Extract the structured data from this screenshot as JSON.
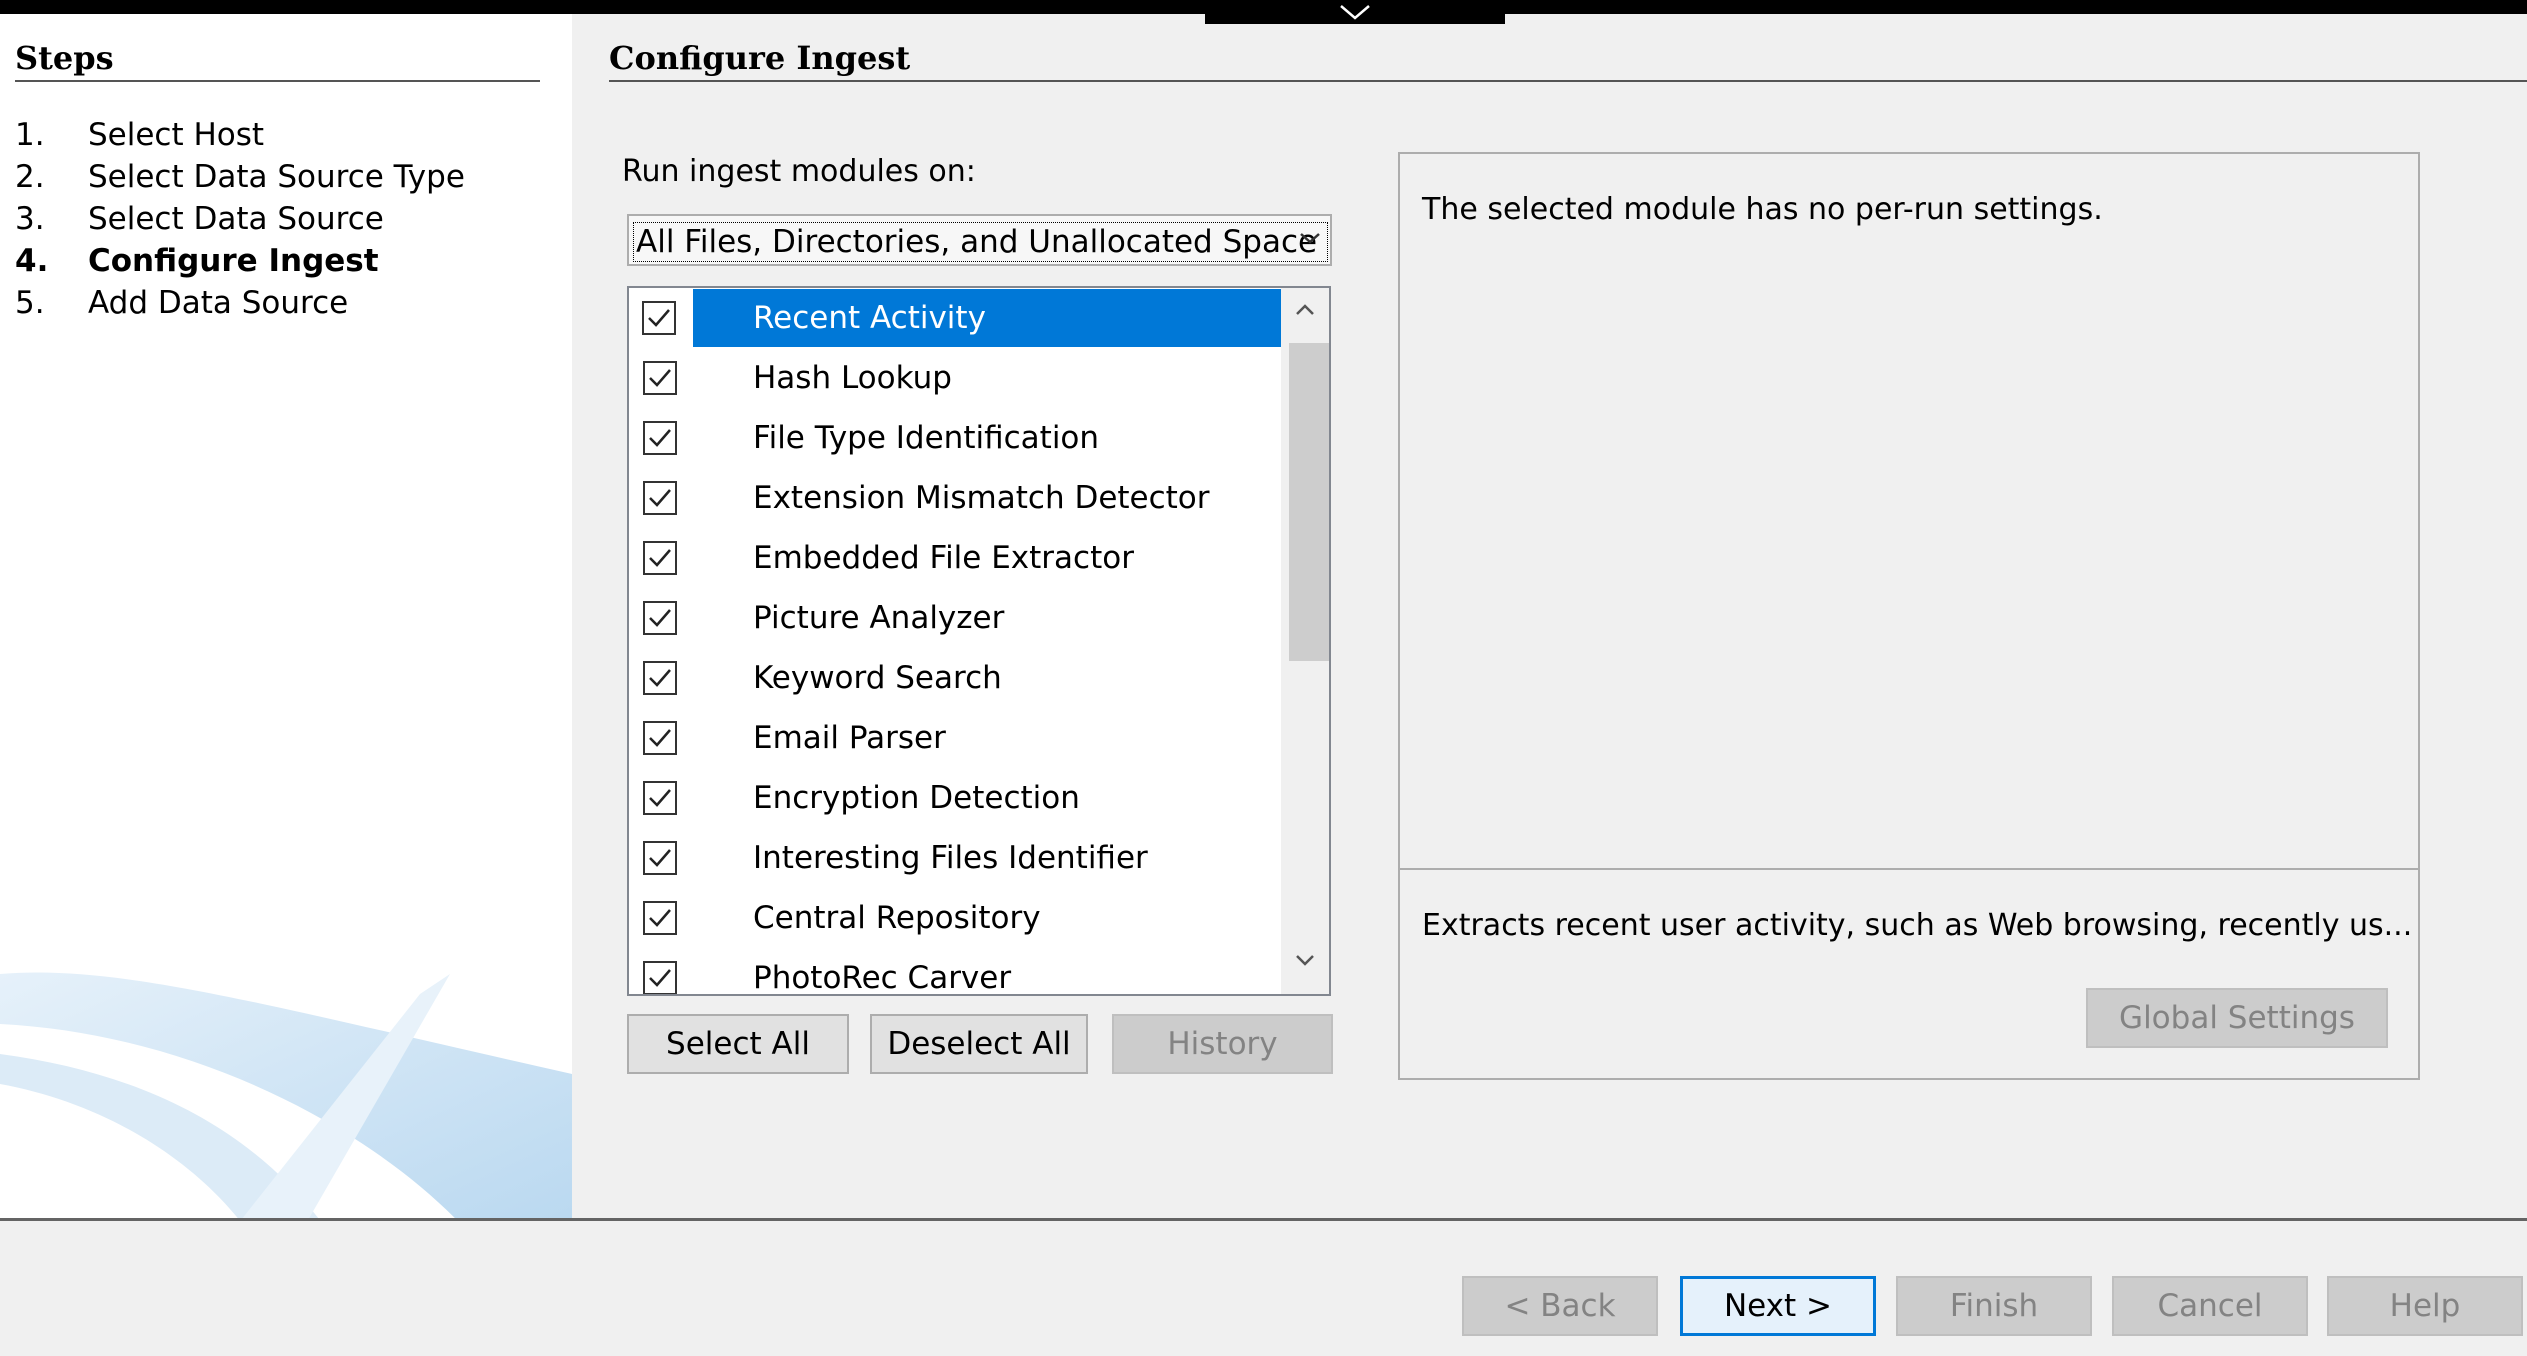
{
  "steps": {
    "title": "Steps",
    "items": [
      {
        "num": "1.",
        "label": "Select Host",
        "current": false
      },
      {
        "num": "2.",
        "label": "Select Data Source Type",
        "current": false
      },
      {
        "num": "3.",
        "label": "Select Data Source",
        "current": false
      },
      {
        "num": "4.",
        "label": "Configure Ingest",
        "current": true
      },
      {
        "num": "5.",
        "label": "Add Data Source",
        "current": false
      }
    ]
  },
  "main": {
    "title": "Configure Ingest",
    "run_label": "Run ingest modules on:",
    "run_value": "All Files, Directories, and Unallocated Space",
    "modules": [
      {
        "label": "Recent Activity",
        "checked": true,
        "selected": true
      },
      {
        "label": "Hash Lookup",
        "checked": true,
        "selected": false
      },
      {
        "label": "File Type Identification",
        "checked": true,
        "selected": false
      },
      {
        "label": "Extension Mismatch Detector",
        "checked": true,
        "selected": false
      },
      {
        "label": "Embedded File Extractor",
        "checked": true,
        "selected": false
      },
      {
        "label": "Picture Analyzer",
        "checked": true,
        "selected": false
      },
      {
        "label": "Keyword Search",
        "checked": true,
        "selected": false
      },
      {
        "label": "Email Parser",
        "checked": true,
        "selected": false
      },
      {
        "label": "Encryption Detection",
        "checked": true,
        "selected": false
      },
      {
        "label": "Interesting Files Identifier",
        "checked": true,
        "selected": false
      },
      {
        "label": "Central Repository",
        "checked": true,
        "selected": false
      },
      {
        "label": "PhotoRec Carver",
        "checked": true,
        "selected": false
      }
    ],
    "select_all": "Select All",
    "deselect_all": "Deselect All",
    "history": "History",
    "settings_msg": "The selected module has no per-run settings.",
    "description": "Extracts recent user activity, such as Web browsing, recently us...",
    "global_settings": "Global Settings"
  },
  "footer": {
    "back": "< Back",
    "next": "Next >",
    "finish": "Finish",
    "cancel": "Cancel",
    "help": "Help"
  },
  "colors": {
    "selection": "#0078d7",
    "panel_bg": "#f0f0f0",
    "disabled_text": "#838383"
  },
  "icons": {
    "checkbox": "checkmark-icon",
    "dropdown": "chevron-down-icon",
    "scroll_up": "chevron-up-icon",
    "scroll_down": "chevron-down-icon"
  }
}
